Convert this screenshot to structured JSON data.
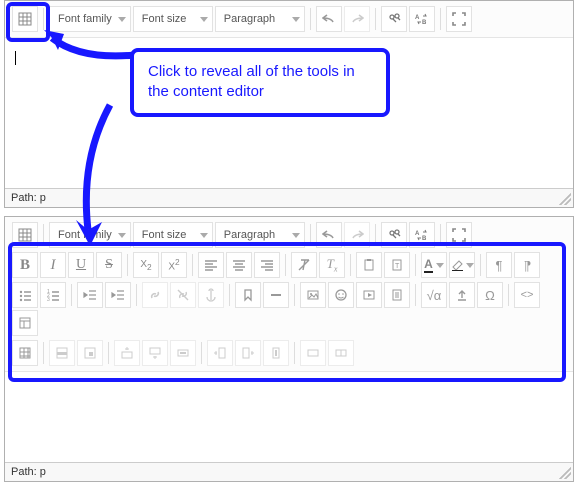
{
  "callout": {
    "text": "Click to reveal all of the tools in the content editor"
  },
  "toolbar": {
    "font_family_label": "Font family",
    "font_size_label": "Font size",
    "format_label": "Paragraph"
  },
  "path": {
    "label": "Path:",
    "value": "p"
  },
  "icons": {
    "toggle": "toggle-toolbar",
    "undo": "undo",
    "redo": "redo",
    "find": "find-replace",
    "find_ab": "find-replace",
    "fullscreen": "fullscreen",
    "bold": "B",
    "italic": "I",
    "underline": "U",
    "strike": "S",
    "sub": "X2",
    "sup": "X2"
  }
}
